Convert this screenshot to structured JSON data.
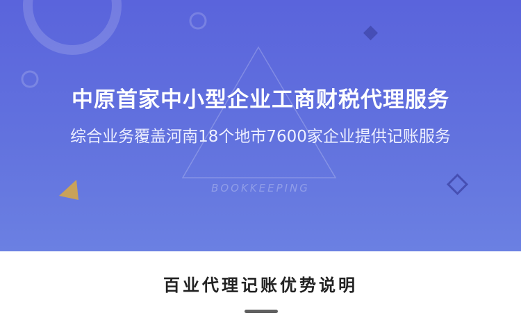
{
  "hero": {
    "title": "中原首家中小型企业工商财税代理服务",
    "subtitle": "综合业务覆盖河南18个地市7600家企业提供记账服务",
    "watermark": "BOOKKEEPING",
    "background_colors": [
      "#5a64dc",
      "#6b80e2"
    ],
    "decorations": [
      "circle-ring-icon",
      "small-circle-icon",
      "small-circle-icon",
      "diamond-icon",
      "triangle-outline-icon",
      "gold-triangle-icon",
      "diamond-outline-icon"
    ],
    "accent_gold": "#c9a25a"
  },
  "section": {
    "heading": "百业代理记账优势说明",
    "underline_color": "#606060"
  }
}
